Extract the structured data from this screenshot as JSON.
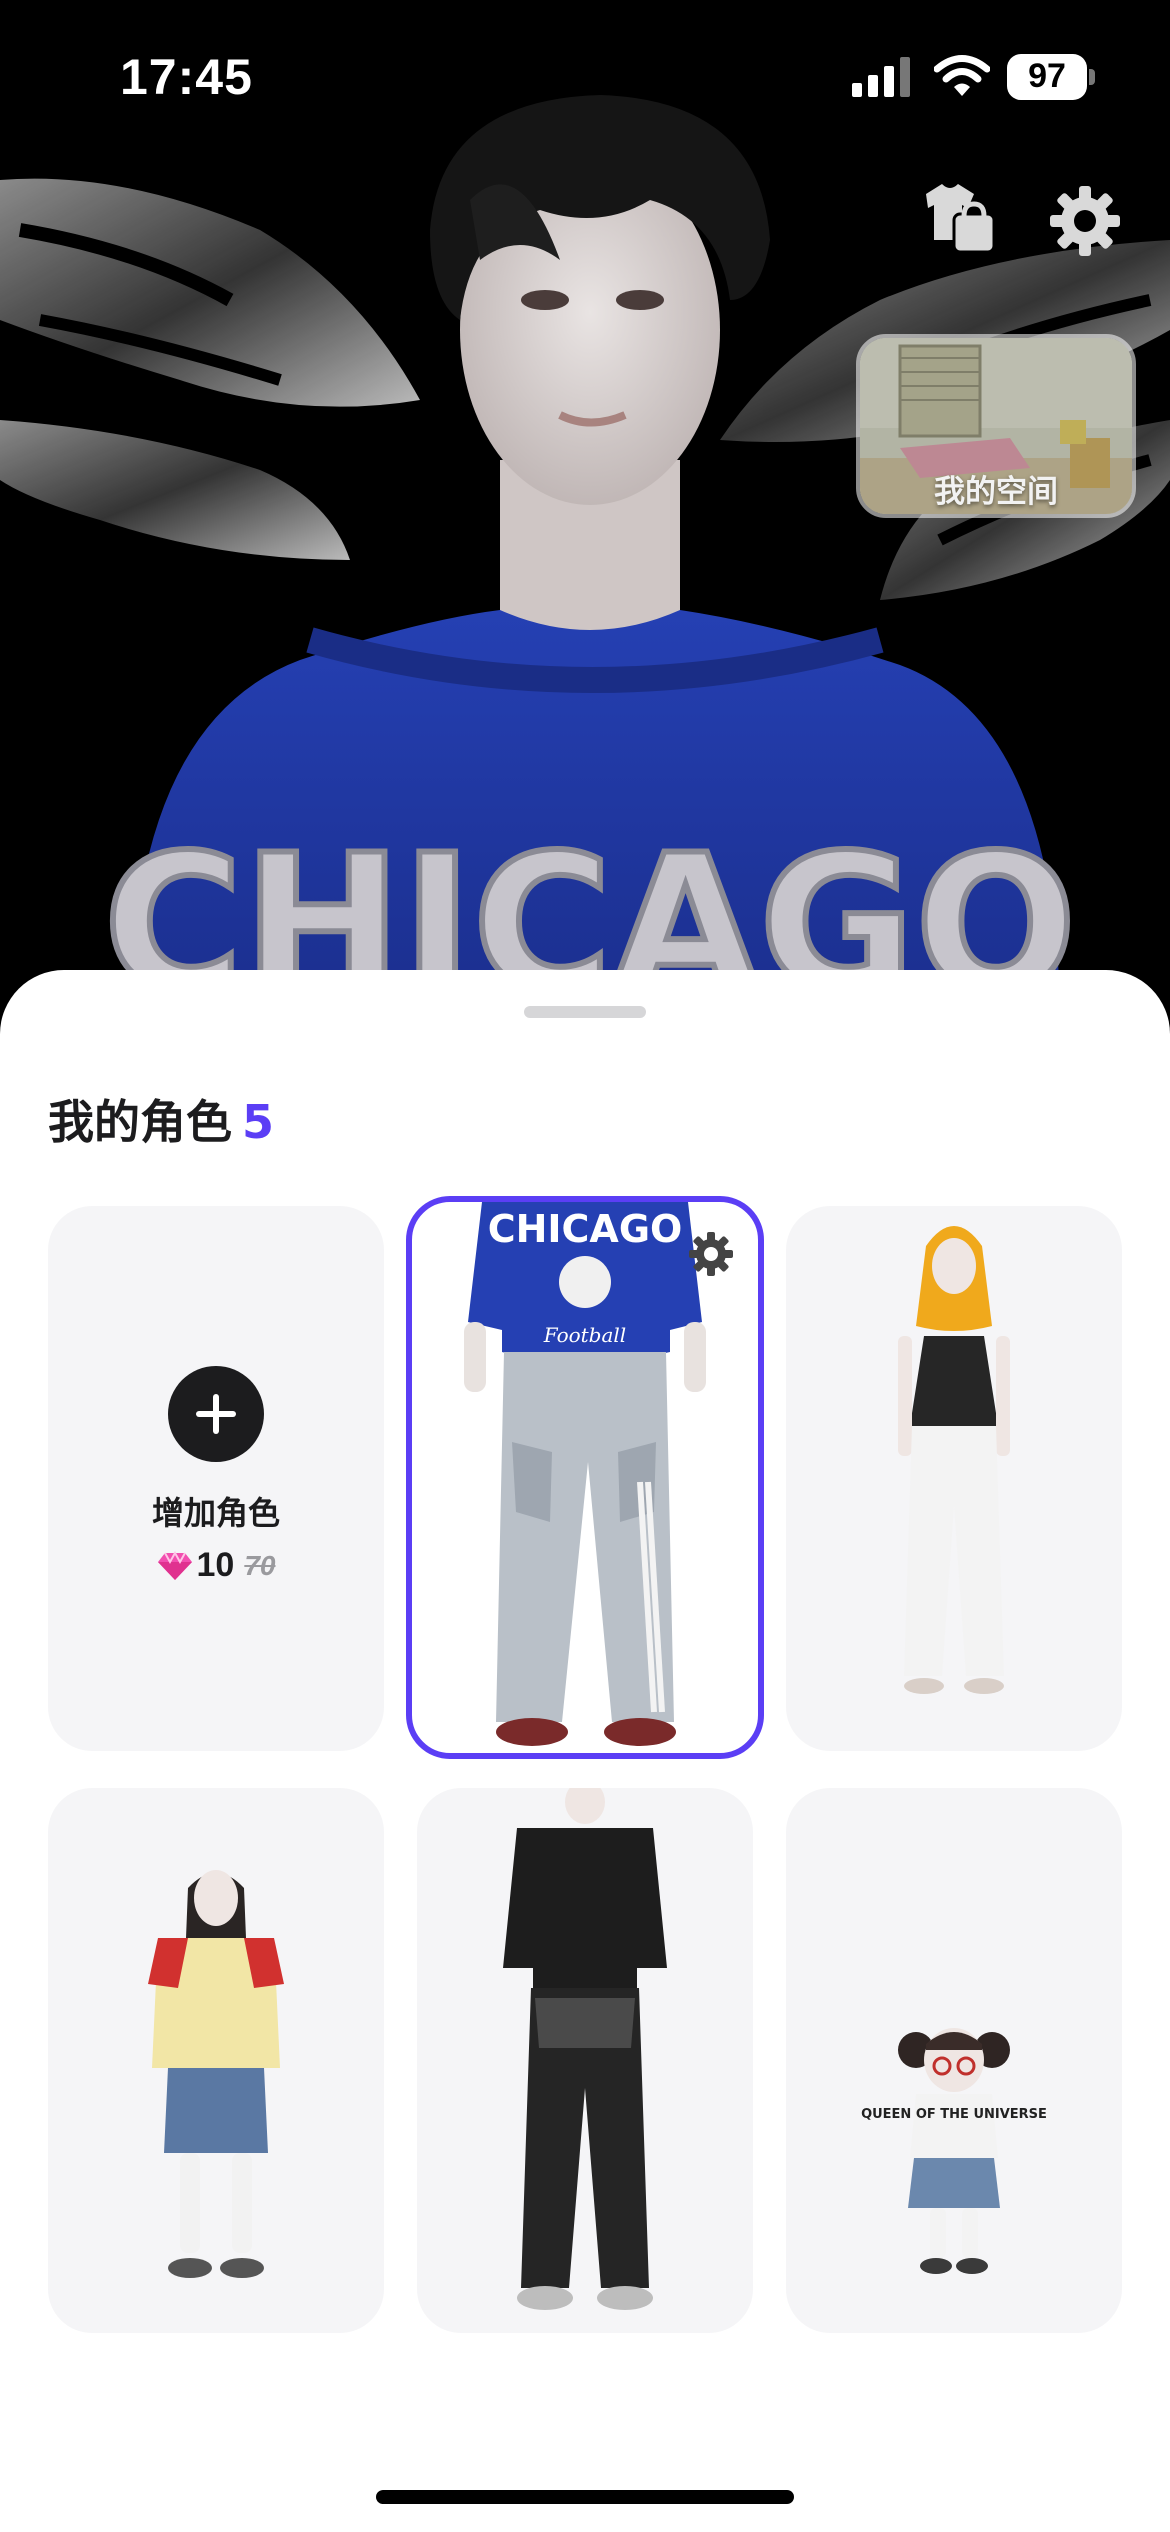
{
  "status_bar": {
    "time": "17:45",
    "battery": "97",
    "icons": [
      "signal-icon",
      "wifi-icon",
      "battery-icon"
    ]
  },
  "top_actions": {
    "icons": [
      "wardrobe-shop-icon",
      "gear-icon"
    ]
  },
  "my_space": {
    "label": "我的空间"
  },
  "sheet": {
    "title": "我的角色",
    "count": "5"
  },
  "add_character": {
    "label": "增加角色",
    "price": "10",
    "original_price": "70",
    "currency_icon": "diamond-icon"
  },
  "hero_character": {
    "shirt_text": "CHICAGO"
  },
  "characters": [
    {
      "name": "character-chicago",
      "shirt_text": "CHICAGO",
      "shirt_subtext": "Football",
      "selected": true
    },
    {
      "name": "character-blonde",
      "selected": false
    },
    {
      "name": "character-red-shirt",
      "selected": false
    },
    {
      "name": "character-black-outfit",
      "selected": false
    },
    {
      "name": "character-queen-shirt",
      "shirt_text": "QUEEN OF THE UNIVERSE",
      "selected": false
    }
  ],
  "colors": {
    "accent": "#5b3ef5",
    "jersey_blue": "#1f3aa6",
    "sheet_bg": "#ffffff",
    "card_bg": "#f5f5f7"
  }
}
